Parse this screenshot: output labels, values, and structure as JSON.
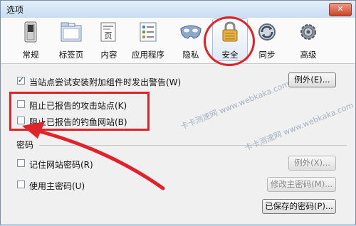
{
  "window": {
    "title": "选项",
    "close_glyph": "✕"
  },
  "tabs": [
    {
      "label": "常规",
      "icon": "switch-icon"
    },
    {
      "label": "标签页",
      "icon": "folder-tabs-icon"
    },
    {
      "label": "内容",
      "icon": "page-icon",
      "glyph": "页"
    },
    {
      "label": "应用程序",
      "icon": "application-list-icon"
    },
    {
      "label": "隐私",
      "icon": "mask-icon"
    },
    {
      "label": "安全",
      "icon": "padlock-icon",
      "active": true
    },
    {
      "label": "同步",
      "icon": "sync-icon"
    },
    {
      "label": "高级",
      "icon": "gear-icon"
    }
  ],
  "security": {
    "warn_addons": {
      "label": "当站点尝试安装附加组件时发出警告(W)",
      "checked": true
    },
    "exceptions_button": "例外(E)...",
    "block_attack": {
      "label": "阻止已报告的攻击站点(K)",
      "checked": false
    },
    "block_forgery": {
      "label": "阻止已报告的钓鱼网站(B)",
      "checked": false
    }
  },
  "passwords": {
    "group_label": "密码",
    "remember": {
      "label": "记住网站密码(R)",
      "checked": false
    },
    "exceptions_button": "例外(X)...",
    "use_master": {
      "label": "使用主密码(U)",
      "checked": false
    },
    "change_master_button": "修改主密码(M)...",
    "saved_passwords_button": "已保存的密码(P)..."
  },
  "watermark": {
    "text1": "卡卡测速网 www.webkaka.com",
    "text2": "卡卡测速网 www.webkaka.com"
  },
  "colors": {
    "annotation_red": "#e0222a",
    "window_bg": "#f0f0f0"
  }
}
